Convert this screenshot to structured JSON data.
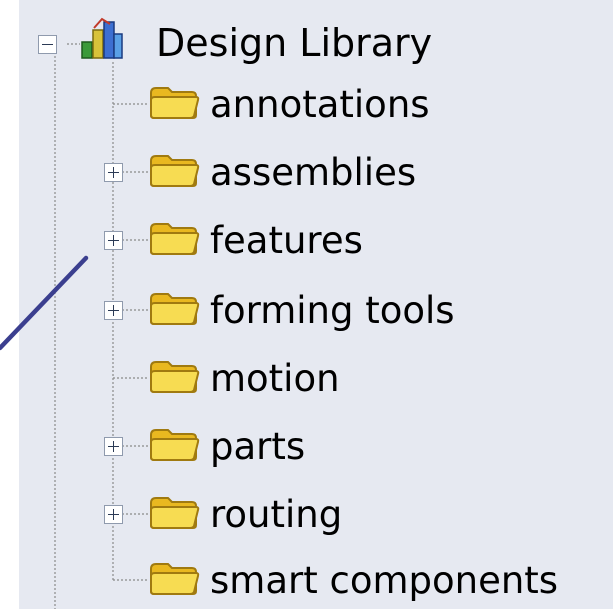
{
  "tree": {
    "root": {
      "label": "Design Library",
      "icon": "design-library-icon",
      "expanded": true
    },
    "items": [
      {
        "label": "annotations",
        "icon": "folder-icon",
        "expandable": false
      },
      {
        "label": "assemblies",
        "icon": "folder-icon",
        "expandable": true
      },
      {
        "label": "features",
        "icon": "folder-icon",
        "expandable": true
      },
      {
        "label": "forming tools",
        "icon": "folder-icon",
        "expandable": true
      },
      {
        "label": "motion",
        "icon": "folder-icon",
        "expandable": false
      },
      {
        "label": "parts",
        "icon": "folder-icon",
        "expandable": true
      },
      {
        "label": "routing",
        "icon": "folder-icon",
        "expandable": true
      },
      {
        "label": "smart components",
        "icon": "folder-icon",
        "expandable": false
      }
    ]
  },
  "colors": {
    "panel_background": "#e6e9f1",
    "callout_line": "#3b3f8f",
    "folder_fill": "#f4d23c",
    "folder_outline": "#a07a10"
  }
}
